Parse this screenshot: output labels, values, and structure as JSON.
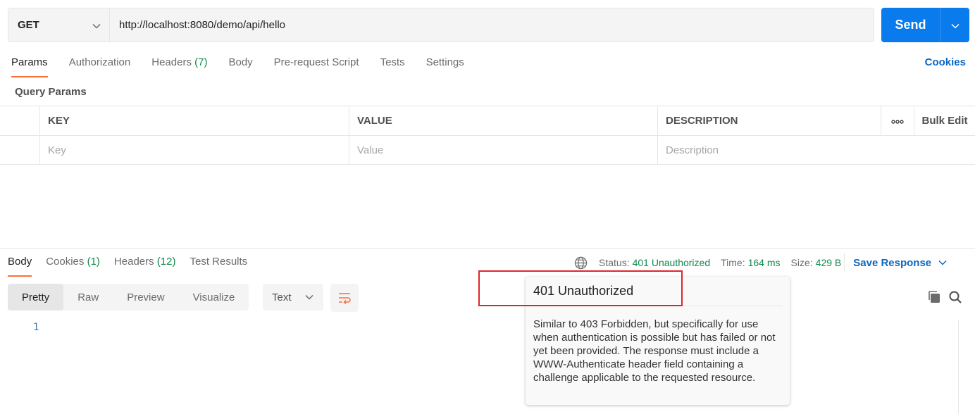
{
  "request": {
    "method": "GET",
    "url": "http://localhost:8080/demo/api/hello",
    "send_label": "Send"
  },
  "request_tabs": [
    {
      "label": "Params",
      "count": ""
    },
    {
      "label": "Authorization",
      "count": ""
    },
    {
      "label": "Headers",
      "count": "(7)"
    },
    {
      "label": "Body",
      "count": ""
    },
    {
      "label": "Pre-request Script",
      "count": ""
    },
    {
      "label": "Tests",
      "count": ""
    },
    {
      "label": "Settings",
      "count": ""
    }
  ],
  "cookies_link": "Cookies",
  "query_params": {
    "title": "Query Params",
    "columns": {
      "key": "KEY",
      "value": "VALUE",
      "description": "DESCRIPTION",
      "more": "•••",
      "bulk_edit": "Bulk Edit"
    },
    "placeholders": {
      "key": "Key",
      "value": "Value",
      "description": "Description"
    }
  },
  "response_tabs": [
    {
      "label": "Body",
      "count": ""
    },
    {
      "label": "Cookies",
      "count": "(1)"
    },
    {
      "label": "Headers",
      "count": "(12)"
    },
    {
      "label": "Test Results",
      "count": ""
    }
  ],
  "response_meta": {
    "status_label": "Status:",
    "status_value": "401 Unauthorized",
    "time_label": "Time:",
    "time_value": "164 ms",
    "size_label": "Size:",
    "size_value": "429 B",
    "save_response": "Save Response"
  },
  "view_modes": [
    "Pretty",
    "Raw",
    "Preview",
    "Visualize"
  ],
  "format": "Text",
  "body_line_number": "1",
  "tooltip": {
    "title": "401 Unauthorized",
    "body": "Similar to 403 Forbidden, but specifically for use when authentication is possible but has failed or not yet been provided. The response must include a WWW-Authenticate header field containing a challenge applicable to the requested resource."
  },
  "colors": {
    "accent": "#097bed",
    "tab_indicator": "#ff6c37",
    "status_ok": "#0d8a4a",
    "link": "#0b66c3",
    "highlight": "#e0252b"
  }
}
